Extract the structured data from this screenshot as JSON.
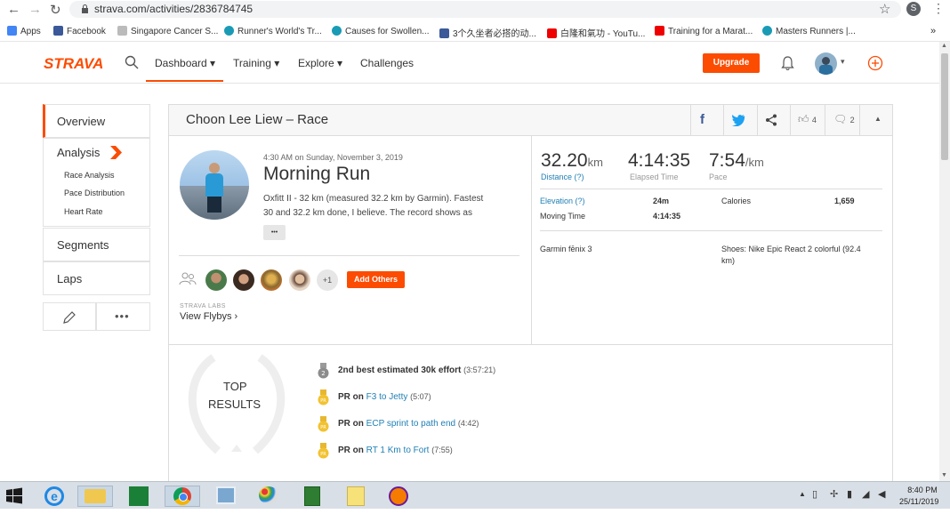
{
  "browser": {
    "url": "strava.com/activities/2836784745",
    "profile_initial": "S",
    "bookmarks": [
      {
        "label": "Apps",
        "color": "#4285f4"
      },
      {
        "label": "Facebook",
        "color": "#3b5998"
      },
      {
        "label": "Singapore Cancer S...",
        "color": "#9aa"
      },
      {
        "label": "Runner's World's Tr...",
        "color": "#1a9bb5"
      },
      {
        "label": "Causes for Swollen...",
        "color": "#1a9bb5"
      },
      {
        "label": "3个久坐者必搭的动...",
        "color": "#3b5998"
      },
      {
        "label": "白隆和氣功 - YouTu...",
        "color": "#e00"
      },
      {
        "label": "Training for a Marat...",
        "color": "#e00"
      },
      {
        "label": "Masters Runners |...",
        "color": "#1a9bb5"
      }
    ]
  },
  "header": {
    "logo": "STRAVA",
    "nav": [
      "Dashboard",
      "Training",
      "Explore",
      "Challenges"
    ],
    "upgrade": "Upgrade",
    "brand_color": "#fc4c02"
  },
  "sidebar": {
    "overview": "Overview",
    "analysis": "Analysis",
    "analysis_items": [
      "Race Analysis",
      "Pace Distribution",
      "Heart Rate"
    ],
    "segments": "Segments",
    "laps": "Laps"
  },
  "activity": {
    "title": "Choon Lee Liew – Race",
    "kudos_count": "4",
    "comment_count": "2",
    "datetime": "4:30 AM on Sunday, November 3, 2019",
    "name": "Morning Run",
    "description_line1": "Oxfitt II - 32 km (measured 32.2 km by Garmin). Fastest",
    "description_line2": "30 and 32.2 km done, I believe. The record shows as",
    "more": "•••",
    "plus_others": "+1",
    "add_others": "Add Others",
    "strava_labs": "STRAVA LABS",
    "view_flybys": "View Flybys ›"
  },
  "stats": {
    "distance_value": "32.20",
    "distance_unit": "km",
    "distance_label": "Distance (?)",
    "elapsed_value": "4:14:35",
    "elapsed_label": "Elapsed Time",
    "pace_value": "7:54",
    "pace_unit": "/km",
    "pace_label": "Pace",
    "elevation_label": "Elevation (?)",
    "elevation_value": "24m",
    "calories_label": "Calories",
    "calories_value": "1,659",
    "moving_label": "Moving Time",
    "moving_value": "4:14:35",
    "device": "Garmin fēnix 3",
    "shoes_line1": "Shoes: Nike Epic React 2 colorful (92.4",
    "shoes_line2": "km)"
  },
  "top_results": {
    "heading_line1": "TOP",
    "heading_line2": "RESULTS",
    "items": [
      {
        "prefix": "2nd best estimated 30k effort",
        "link": "",
        "time": "(3:57:21)",
        "medal": "silver"
      },
      {
        "prefix": "PR on ",
        "link": "F3 to Jetty",
        "time": "(5:07)",
        "medal": "gold"
      },
      {
        "prefix": "PR on ",
        "link": "ECP sprint to path end",
        "time": "(4:42)",
        "medal": "gold"
      },
      {
        "prefix": "PR on ",
        "link": "RT 1 Km to Fort",
        "time": "(7:55)",
        "medal": "gold"
      }
    ]
  },
  "taskbar": {
    "time": "8:40 PM",
    "date": "25/11/2019"
  }
}
